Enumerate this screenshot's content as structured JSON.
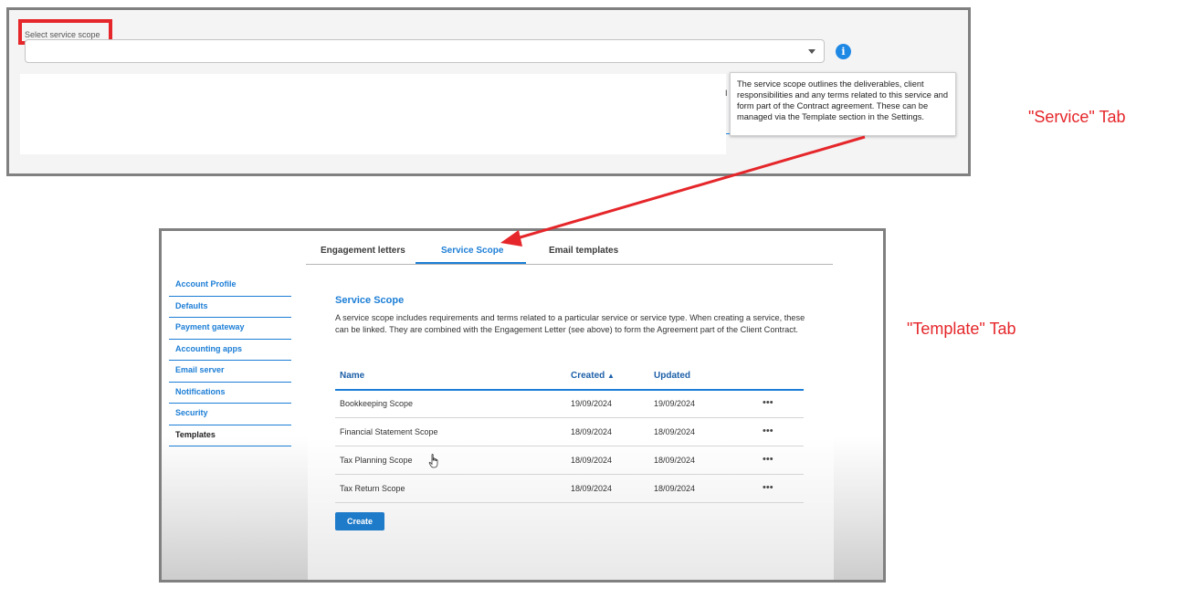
{
  "service_tab": {
    "select_label": "Select service scope",
    "select_value": "",
    "info_icon_glyph": "i",
    "tooltip_text": "The service scope outlines the deliverables, client responsibilities and any terms related to this service and form part of the Contract agreement. These can be managed via the Template section in the Settings.",
    "fragment_letter": "I"
  },
  "annotations": {
    "service_tab_label": "\"Service\" Tab",
    "template_tab_label": "\"Template\" Tab",
    "color": "#e5262a"
  },
  "template_tab": {
    "tabs": [
      {
        "label": "Engagement letters",
        "active": false
      },
      {
        "label": "Service Scope",
        "active": true
      },
      {
        "label": "Email templates",
        "active": false
      }
    ],
    "sidebar": [
      {
        "label": "Account Profile"
      },
      {
        "label": "Defaults"
      },
      {
        "label": "Payment gateway"
      },
      {
        "label": "Accounting apps"
      },
      {
        "label": "Email server"
      },
      {
        "label": "Notifications"
      },
      {
        "label": "Security"
      },
      {
        "label": "Templates",
        "current": true
      }
    ],
    "section_title": "Service Scope",
    "section_description": "A service scope includes requirements and terms related to a particular service or service type. When creating a service, these can be linked. They are combined with the Engagement Letter (see above) to form the Agreement part of the Client Contract.",
    "table": {
      "headers": {
        "name": "Name",
        "created": "Created",
        "sort_indicator": "▲",
        "updated": "Updated"
      },
      "rows": [
        {
          "name": "Bookkeeping Scope",
          "created": "19/09/2024",
          "updated": "19/09/2024",
          "menu": "•••"
        },
        {
          "name": "Financial Statement Scope",
          "created": "18/09/2024",
          "updated": "18/09/2024",
          "menu": "•••"
        },
        {
          "name": "Tax Planning Scope",
          "created": "18/09/2024",
          "updated": "18/09/2024",
          "menu": "•••"
        },
        {
          "name": "Tax Return Scope",
          "created": "18/09/2024",
          "updated": "18/09/2024",
          "menu": "•••"
        }
      ]
    },
    "create_button": "Create",
    "accent_color": "#1c7ed6"
  }
}
